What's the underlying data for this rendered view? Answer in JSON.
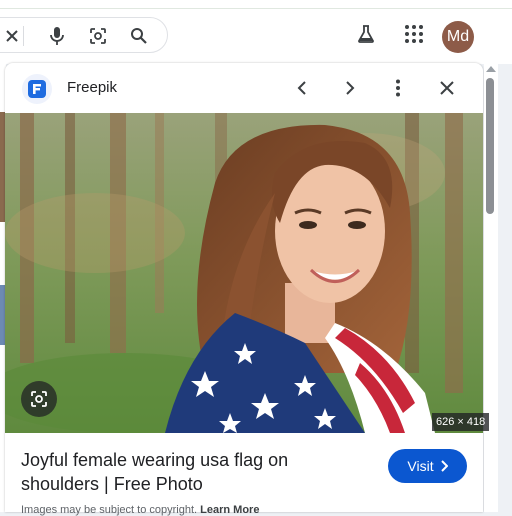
{
  "browser_bar": {
    "avatar_initials": "Md",
    "icons": [
      "close-icon",
      "microphone-icon",
      "lens-icon",
      "search-icon",
      "labs-flask-icon",
      "apps-grid-icon"
    ]
  },
  "panel": {
    "source_name": "Freepik",
    "source_logo": "freepik-logo",
    "image_dimensions": "626 × 418",
    "title": "Joyful female wearing usa flag on shoulders | Free Photo",
    "visit_label": "Visit",
    "copyright_text": "Images may be subject to copyright.",
    "learn_more_label": "Learn More"
  },
  "colors": {
    "accent": "#0b57d0",
    "avatar_bg": "#8d5b48"
  }
}
